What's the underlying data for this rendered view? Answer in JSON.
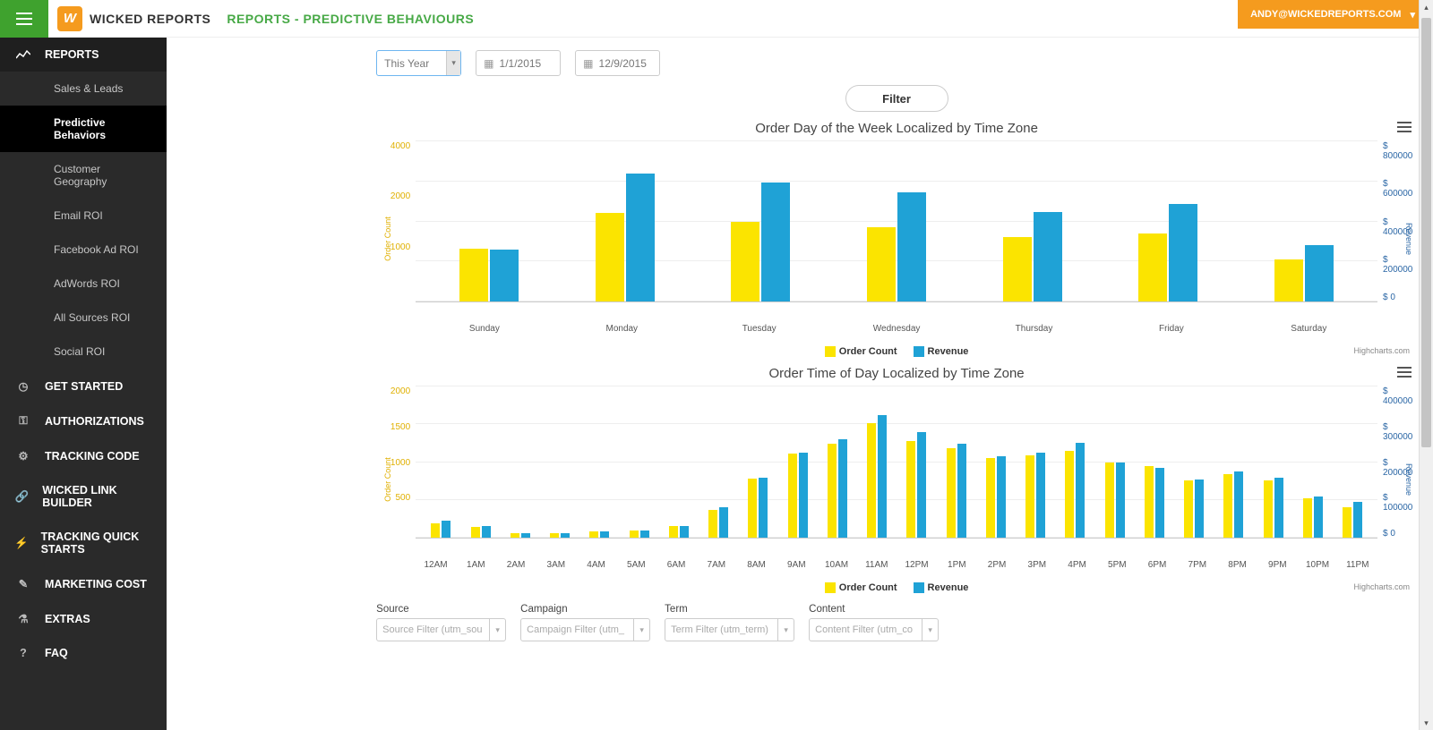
{
  "brand": "WICKED REPORTS",
  "page_title": "REPORTS - PREDICTIVE BEHAVIOURS",
  "user_email": "ANDY@WICKEDREPORTS.COM",
  "hc_credit": "Highcharts.com",
  "nav": {
    "reports": "REPORTS",
    "items": [
      "Sales & Leads",
      "Predictive Behaviors",
      "Customer Geography",
      "Email ROI",
      "Facebook Ad ROI",
      "AdWords ROI",
      "All Sources ROI",
      "Social ROI"
    ],
    "bottom": [
      "GET STARTED",
      "AUTHORIZATIONS",
      "TRACKING CODE",
      "WICKED LINK BUILDER",
      "TRACKING QUICK STARTS",
      "MARKETING COST",
      "EXTRAS",
      "FAQ"
    ]
  },
  "controls": {
    "range": "This Year",
    "date_start": "1/1/2015",
    "date_end": "12/9/2015",
    "filter": "Filter"
  },
  "legend": {
    "order_count": "Order Count",
    "revenue": "Revenue"
  },
  "chart_data": [
    {
      "type": "bar",
      "title": "Order Day of the Week Localized by Time Zone",
      "categories": [
        "Sunday",
        "Monday",
        "Tuesday",
        "Wednesday",
        "Thursday",
        "Friday",
        "Saturday"
      ],
      "y_left": {
        "label": "Order Count",
        "ticks": [
          4000,
          2000,
          1000
        ],
        "max": 4000,
        "min": 0
      },
      "y_right": {
        "label": "Revenue",
        "ticks": [
          "$ 800000",
          "$ 600000",
          "$ 400000",
          "$ 200000",
          "$ 0"
        ],
        "max": 800000,
        "min": 0
      },
      "series": [
        {
          "name": "Order Count",
          "color": "#fbe400",
          "values": [
            1310,
            2220,
            1980,
            1850,
            1620,
            1700,
            1050
          ]
        },
        {
          "name": "Revenue",
          "color": "#1fa2d6",
          "values": [
            260000,
            640000,
            595000,
            545000,
            445000,
            485000,
            280000
          ]
        }
      ]
    },
    {
      "type": "bar",
      "title": "Order Time of Day Localized by Time Zone",
      "categories": [
        "12AM",
        "1AM",
        "2AM",
        "3AM",
        "4AM",
        "5AM",
        "6AM",
        "7AM",
        "8AM",
        "9AM",
        "10AM",
        "11AM",
        "12PM",
        "1PM",
        "2PM",
        "3PM",
        "4PM",
        "5PM",
        "6PM",
        "7PM",
        "8PM",
        "9PM",
        "10PM",
        "11PM"
      ],
      "y_left": {
        "label": "Order Count",
        "ticks": [
          2000,
          1500,
          1000,
          500
        ],
        "max": 2000,
        "min": 0
      },
      "y_right": {
        "label": "Revenue",
        "ticks": [
          "$ 400000",
          "$ 300000",
          "$ 200000",
          "$ 100000",
          "$ 0"
        ],
        "max": 400000,
        "min": 0
      },
      "series": [
        {
          "name": "Order Count",
          "color": "#fbe400",
          "values": [
            190,
            140,
            60,
            55,
            80,
            100,
            150,
            370,
            780,
            1110,
            1240,
            1520,
            1280,
            1180,
            1060,
            1090,
            1150,
            990,
            950,
            760,
            840,
            760,
            520,
            400
          ]
        },
        {
          "name": "Revenue",
          "color": "#1fa2d6",
          "values": [
            45000,
            30000,
            12000,
            12000,
            18000,
            20000,
            30000,
            80000,
            160000,
            225000,
            260000,
            324000,
            280000,
            248000,
            215000,
            225000,
            250000,
            200000,
            185000,
            155000,
            175000,
            160000,
            110000,
            95000
          ]
        }
      ]
    }
  ],
  "bottom_filters": {
    "source": {
      "label": "Source",
      "placeholder": "Source Filter (utm_sou"
    },
    "campaign": {
      "label": "Campaign",
      "placeholder": "Campaign Filter (utm_"
    },
    "term": {
      "label": "Term",
      "placeholder": "Term Filter (utm_term)"
    },
    "content": {
      "label": "Content",
      "placeholder": "Content Filter (utm_co"
    }
  }
}
